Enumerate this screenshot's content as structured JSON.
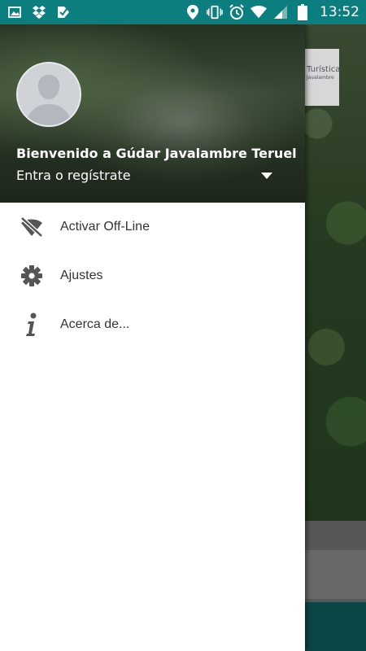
{
  "status_bar": {
    "time": "13:52",
    "left_icons": [
      "image-icon",
      "dropbox-icon",
      "checkbox-app-icon"
    ],
    "right_icons": [
      "location-pin-icon",
      "vibrate-icon",
      "alarm-icon",
      "wifi-icon",
      "signal-icon",
      "battery-icon"
    ]
  },
  "background_app": {
    "logo_text": "Turística",
    "logo_subtext": "Javalambre"
  },
  "drawer": {
    "header": {
      "welcome": "Bienvenido a Gúdar Javalambre Teruel",
      "account_prompt": "Entra o regístrate",
      "avatar_icon": "default-avatar-icon"
    },
    "items": [
      {
        "label": "Activar Off-Line",
        "icon": "wifi-off-icon"
      },
      {
        "label": "Ajustes",
        "icon": "settings-gear-icon"
      },
      {
        "label": "Acerca de...",
        "icon": "info-icon"
      }
    ]
  },
  "colors": {
    "status_bar": "#0d7e7f",
    "menu_icon": "#555555",
    "menu_text": "#333333"
  }
}
